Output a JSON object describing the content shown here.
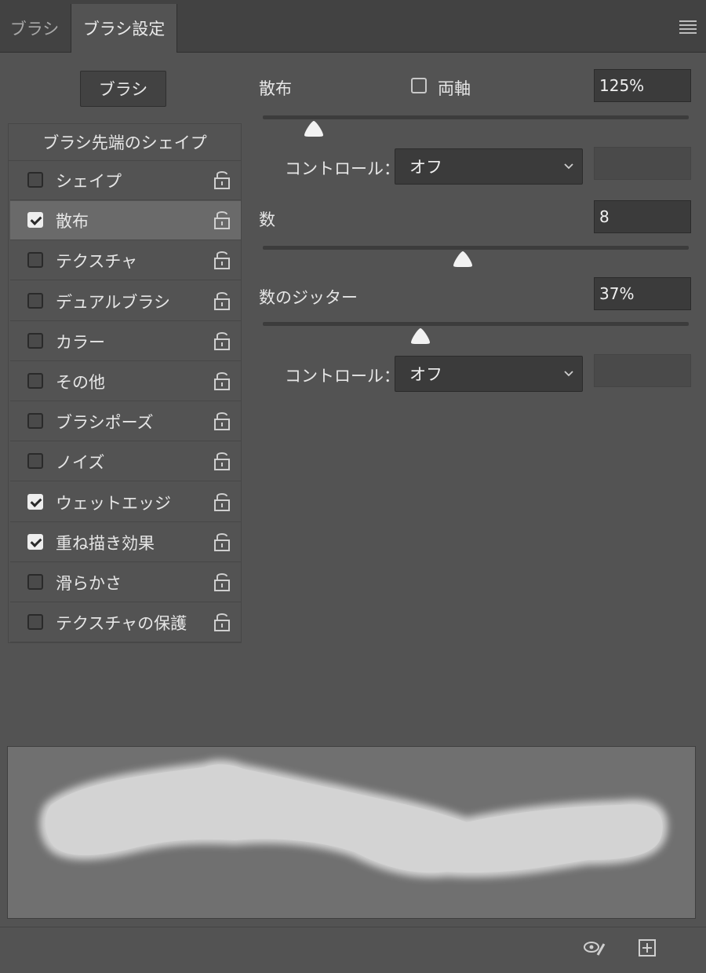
{
  "tabs": [
    {
      "label": "ブラシ",
      "active": false
    },
    {
      "label": "ブラシ設定",
      "active": true
    }
  ],
  "brush_button_label": "ブラシ",
  "list": {
    "header": "ブラシ先端のシェイプ",
    "items": [
      {
        "label": "シェイプ",
        "checked": false,
        "selected": false
      },
      {
        "label": "散布",
        "checked": true,
        "selected": true
      },
      {
        "label": "テクスチャ",
        "checked": false,
        "selected": false
      },
      {
        "label": "デュアルブラシ",
        "checked": false,
        "selected": false
      },
      {
        "label": "カラー",
        "checked": false,
        "selected": false
      },
      {
        "label": "その他",
        "checked": false,
        "selected": false
      },
      {
        "label": "ブラシポーズ",
        "checked": false,
        "selected": false
      },
      {
        "label": "ノイズ",
        "checked": false,
        "selected": false
      },
      {
        "label": "ウェットエッジ",
        "checked": true,
        "selected": false
      },
      {
        "label": "重ね描き効果",
        "checked": true,
        "selected": false
      },
      {
        "label": "滑らかさ",
        "checked": false,
        "selected": false
      },
      {
        "label": "テクスチャの保護",
        "checked": false,
        "selected": false
      }
    ]
  },
  "scatter": {
    "label": "散布",
    "both_axes_label": "両軸",
    "both_axes_checked": false,
    "value": "125%",
    "slider_fraction": 0.12,
    "control_label": "コントロール：",
    "control_value": "オフ"
  },
  "count": {
    "label": "数",
    "value": "8",
    "slider_fraction": 0.47
  },
  "count_jitter": {
    "label": "数のジッター",
    "value": "37%",
    "slider_fraction": 0.37,
    "control_label": "コントロール：",
    "control_value": "オフ"
  },
  "icons": {
    "menu": "panel-menu-icon",
    "lock": "lock-icon",
    "eye": "eye-brush-icon",
    "new": "new-preset-icon"
  },
  "colors": {
    "panel_bg": "#535353",
    "tabbar_bg": "#424242",
    "selected_row": "#6a6a6a",
    "field_bg": "#3b3b3b",
    "preview_bg": "#707070",
    "stroke": "#d3d3d3"
  }
}
